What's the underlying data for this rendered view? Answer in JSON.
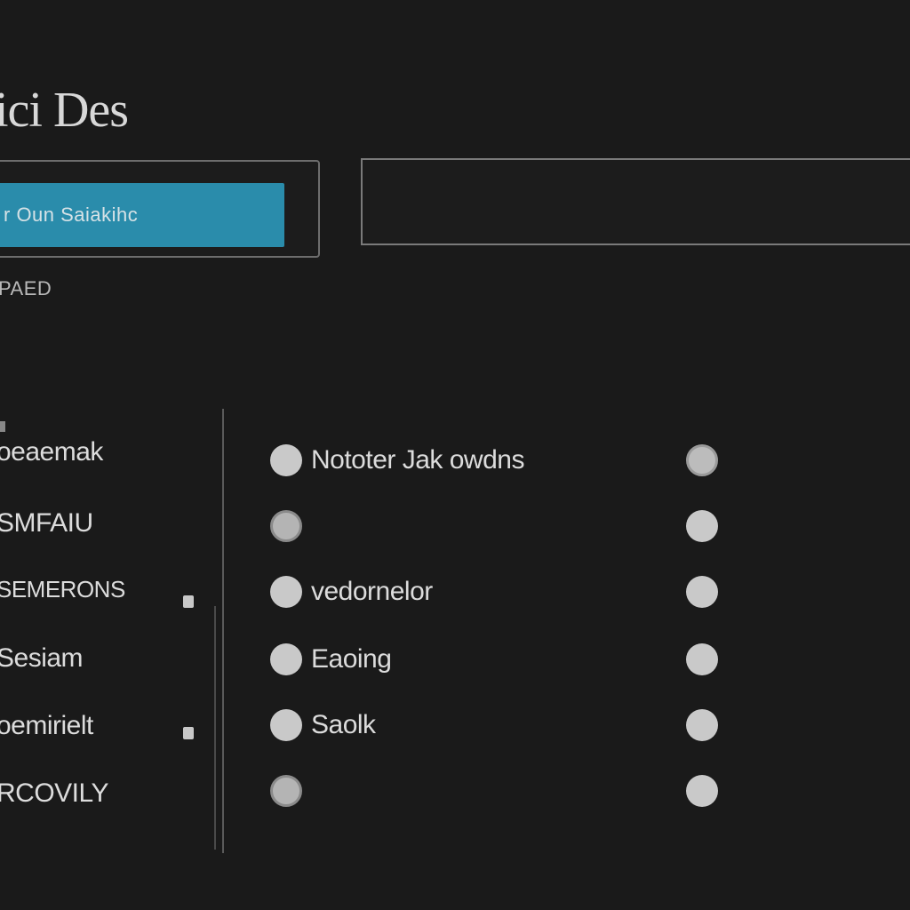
{
  "header": {
    "title": "ici Des"
  },
  "search": {
    "value": "r Oun Saiakihc"
  },
  "section": {
    "label": "PAED"
  },
  "sidebar": {
    "items": [
      {
        "label": "oeaemak"
      },
      {
        "label": "SMFAIU"
      },
      {
        "label": "SEMERONS"
      },
      {
        "label": "Sesiam"
      },
      {
        "label": "oemirielt"
      },
      {
        "label": "RCOVILY"
      }
    ]
  },
  "options": [
    {
      "label": "Nototer Jak owdns",
      "left_selected": false,
      "right_selected": true
    },
    {
      "label": "",
      "left_selected": true,
      "right_selected": false
    },
    {
      "label": "vedornelor",
      "left_selected": false,
      "right_selected": false
    },
    {
      "label": "Eaoing",
      "left_selected": false,
      "right_selected": false
    },
    {
      "label": "Saolk",
      "left_selected": false,
      "right_selected": false
    },
    {
      "label": "",
      "left_selected": false,
      "right_selected": false
    }
  ],
  "colors": {
    "background": "#1a1a1a",
    "accent": "#2a8cab",
    "text": "#dcdcdc",
    "radio": "#c9c9c9"
  }
}
